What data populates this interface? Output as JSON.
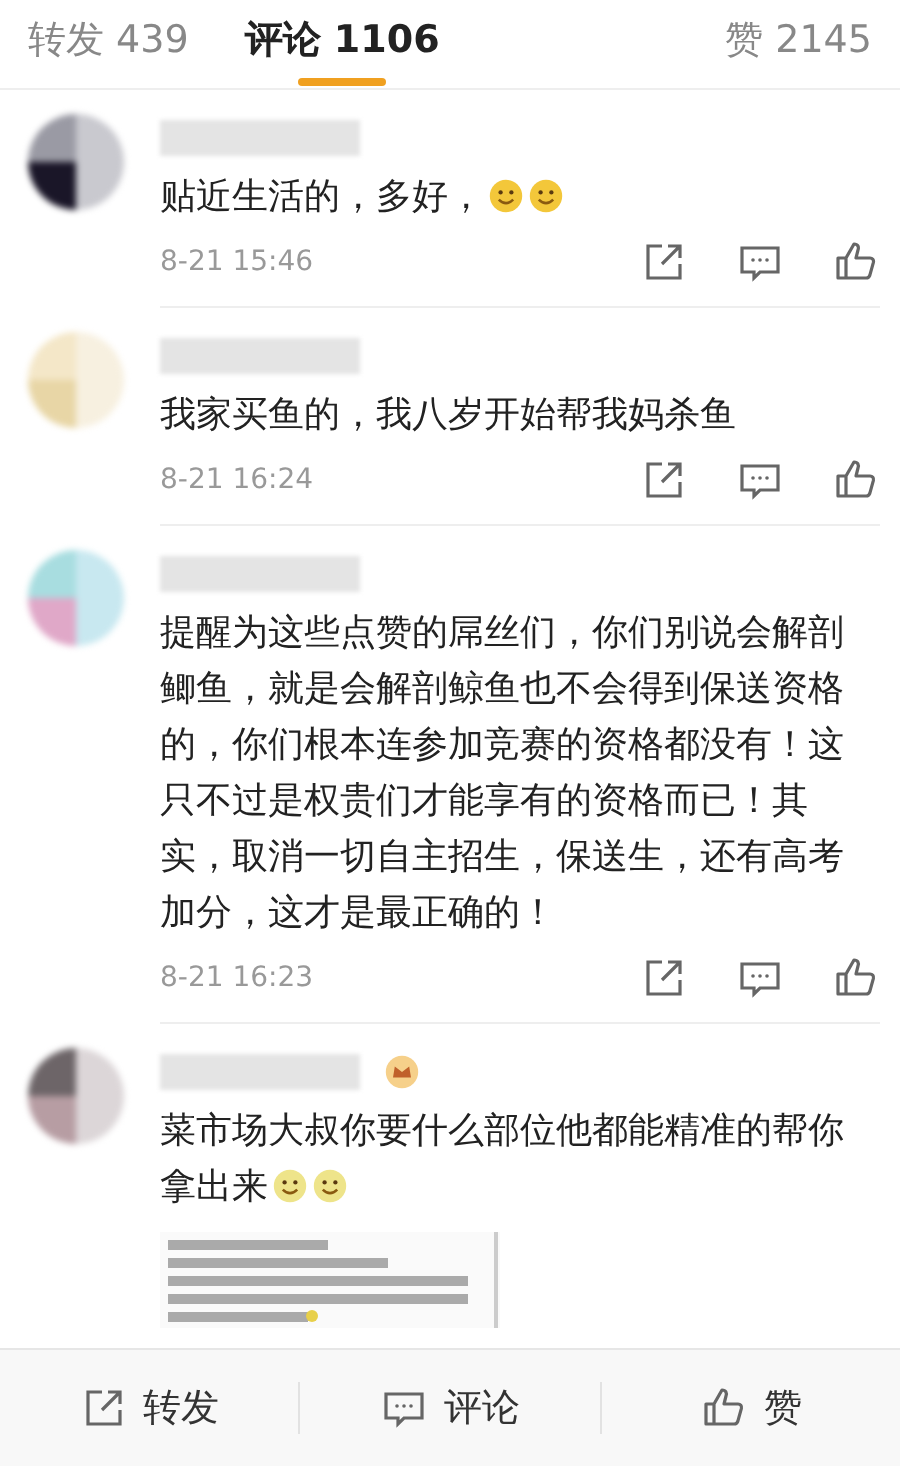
{
  "tabs": [
    {
      "label": "转发 439",
      "selected": false
    },
    {
      "label": "评论 1106",
      "selected": true
    },
    {
      "label": "赞 2145",
      "selected": false
    }
  ],
  "comments": [
    {
      "kind": "emoji",
      "text": "贴近生活的，多好，",
      "time": "8-21 15:46"
    },
    {
      "kind": "plain",
      "text": "我家买鱼的，我八岁开始帮我妈杀鱼",
      "time": "8-21 16:24"
    },
    {
      "kind": "plain",
      "text": "提醒为这些点赞的屌丝们，你们别说会解剖鲫鱼，就是会解剖鲸鱼也不会得到保送资格的，你们根本连参加竞赛的资格都没有！这只不过是权贵们才能享有的资格而已！其实，取消一切自主招生，保送生，还有高考加分，这才是最正确的！",
      "time": "8-21 16:23"
    },
    {
      "text": "菜市场大叔你要什么部位他都能精准的帮你拿出来"
    }
  ],
  "bottom_bar": [
    {
      "kind": "repost",
      "label": "转发"
    },
    {
      "kind": "comment",
      "label": "评论"
    },
    {
      "kind": "like",
      "label": "赞"
    }
  ]
}
